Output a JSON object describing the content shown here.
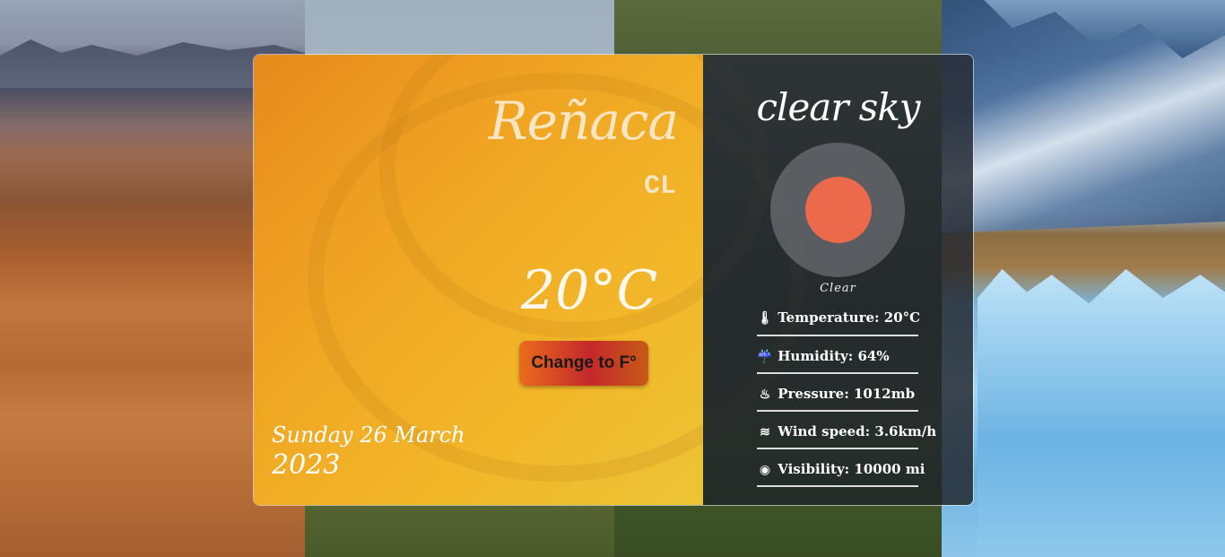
{
  "city": "Reñaca",
  "country": "CL",
  "temperature": "20°C",
  "toggle_label": "Change to F°",
  "date": {
    "line1": "Sunday 26 March",
    "line2": "2023"
  },
  "description": "clear sky",
  "icon": {
    "name": "sun-icon",
    "label": "Clear",
    "color": "#ec6a4b"
  },
  "stats": [
    {
      "icon": "thermometer-icon",
      "glyph": "🌡",
      "text": "Temperature: 20°C"
    },
    {
      "icon": "humidity-icon",
      "glyph": "☔",
      "text": "Humidity: 64%"
    },
    {
      "icon": "pressure-icon",
      "glyph": "♨",
      "text": "Pressure: 1012mb"
    },
    {
      "icon": "wind-icon",
      "glyph": "≋",
      "text": "Wind speed: 3.6km/h"
    },
    {
      "icon": "eye-icon",
      "glyph": "◉",
      "text": "Visibility: 10000 mi"
    }
  ],
  "colors": {
    "card_left": "#f0a422",
    "button": "#c4282a",
    "sun": "#ec6a4b"
  }
}
